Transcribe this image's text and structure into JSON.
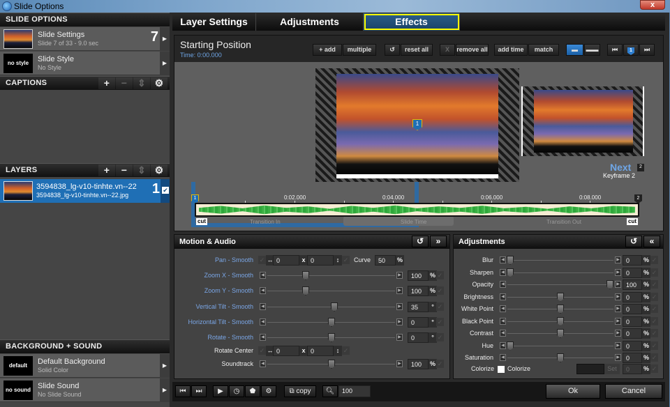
{
  "window": {
    "title": "Slide Options",
    "close_label": "x"
  },
  "left": {
    "slide_options_header": "SLIDE OPTIONS",
    "slide_settings": {
      "title": "Slide Settings",
      "subtitle": "Slide 7 of 33 - 9.0 sec",
      "number": "7"
    },
    "slide_style": {
      "thumb_text": "no style",
      "title": "Slide Style",
      "subtitle": "No Style"
    },
    "captions_header": "CAPTIONS",
    "layers_header": "LAYERS",
    "layer": {
      "title": "3594838_lg-v10-tinhte.vn--22",
      "subtitle": "3594838_lg-v10-tinhte.vn--22.jpg",
      "number": "1",
      "checked": true
    },
    "bg_sound_header": "BACKGROUND + SOUND",
    "background": {
      "thumb_text": "default",
      "title": "Default Background",
      "subtitle": "Solid Color"
    },
    "sound": {
      "thumb_text": "no sound",
      "title": "Slide Sound",
      "subtitle": "No Slide Sound"
    },
    "header_buttons": {
      "add": "+",
      "remove": "−",
      "updown": "⇕",
      "gear": "⚙"
    }
  },
  "tabs": [
    {
      "label": "Layer Settings"
    },
    {
      "label": "Adjustments"
    },
    {
      "label": "Effects",
      "active": true
    }
  ],
  "keyframe": {
    "title": "Starting Position",
    "time": "Time: 0:00.000",
    "toolbar": {
      "add": "+ add",
      "multiple": "multiple",
      "reset_icon": "↺",
      "reset_all": "reset all",
      "remove_icon": "X",
      "remove_all": "remove all",
      "add_time": "add time",
      "match": "match",
      "marker_num": "1"
    },
    "marker1": "1",
    "next_label": "Next",
    "next_num": "2",
    "next_sub": "Keyframe 2"
  },
  "timeline": {
    "start_marker": "1",
    "end_marker": "2",
    "ticks": [
      "0:02.000",
      "0:04.000",
      "0:06.000",
      "0:08.000"
    ],
    "cut_label": "cut",
    "segments": [
      "Transition In",
      "Slide Time",
      "Transition Out"
    ]
  },
  "motion": {
    "header": "Motion & Audio",
    "rows": [
      {
        "label": "Pan - Smooth",
        "type": "xy",
        "x": "0",
        "y": "0",
        "curve_label": "Curve",
        "curve": "50",
        "unit": "%"
      },
      {
        "label": "Zoom X - Smooth",
        "type": "slider",
        "value": "100",
        "unit": "%",
        "pos": 0.28
      },
      {
        "label": "Zoom Y - Smooth",
        "type": "slider",
        "value": "100",
        "unit": "%",
        "pos": 0.28
      },
      {
        "label": "Vertical Tilt - Smooth",
        "type": "slider",
        "value": "35",
        "unit": "°",
        "pos": 0.53
      },
      {
        "label": "Horizontal Tilt - Smooth",
        "type": "slider",
        "value": "0",
        "unit": "°",
        "pos": 0.5
      },
      {
        "label": "Rotate - Smooth",
        "type": "slider",
        "value": "0",
        "unit": "°",
        "pos": 0.5
      },
      {
        "label": "Rotate Center",
        "type": "xy",
        "x": "0",
        "y": "0"
      },
      {
        "label": "Soundtrack",
        "type": "slider",
        "value": "100",
        "unit": "%",
        "pos": 0.5
      }
    ]
  },
  "adjustments": {
    "header": "Adjustments",
    "rows": [
      {
        "label": "Blur",
        "value": "0",
        "unit": "%",
        "pos": 0.0
      },
      {
        "label": "Sharpen",
        "value": "0",
        "unit": "%",
        "pos": 0.0
      },
      {
        "label": "Opacity",
        "value": "100",
        "unit": "%",
        "pos": 1.0
      },
      {
        "label": "Brightness",
        "value": "0",
        "unit": "%",
        "pos": 0.5
      },
      {
        "label": "White Point",
        "value": "0",
        "unit": "%",
        "pos": 0.5
      },
      {
        "label": "Black Point",
        "value": "0",
        "unit": "%",
        "pos": 0.5
      },
      {
        "label": "Contrast",
        "value": "0",
        "unit": "%",
        "pos": 0.5
      },
      {
        "label": "Hue",
        "value": "0",
        "unit": "%",
        "pos": 0.0
      },
      {
        "label": "Saturation",
        "value": "0",
        "unit": "%",
        "pos": 0.5
      }
    ],
    "colorize": {
      "label": "Colorize",
      "checkbox_label": "Colorize",
      "set_label": "Set",
      "value": "0",
      "unit": "%"
    }
  },
  "bottom": {
    "copy": "copy",
    "zoom_value": "100",
    "ok": "Ok",
    "cancel": "Cancel"
  }
}
